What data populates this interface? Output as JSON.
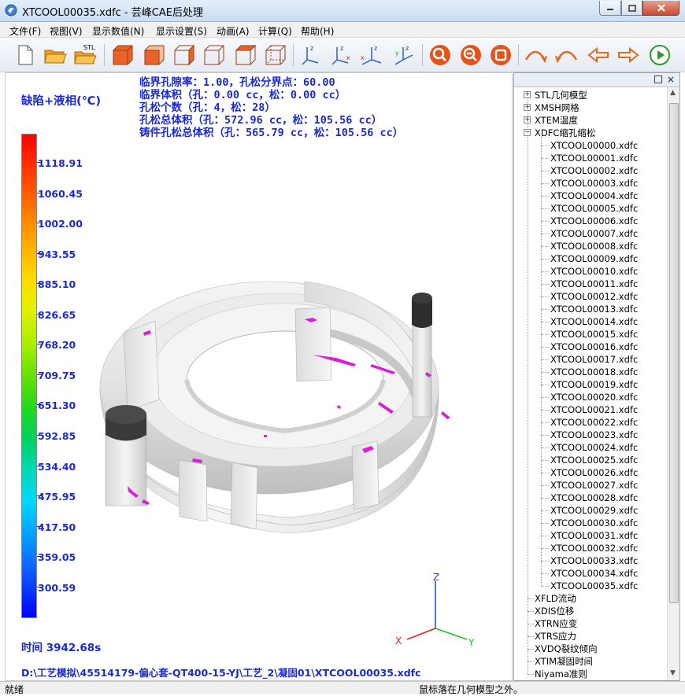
{
  "window": {
    "title": "XTCOOL00035.xdfc - 芸峰CAE后处理"
  },
  "menu": [
    "文件(F)",
    "视图(V)",
    "显示数值(N)",
    "显示设置(S)",
    "动画(A)",
    "计算(Q)",
    "帮助(H)"
  ],
  "toolbar": {
    "stl_label": "STL",
    "buttons": [
      "new-file-icon",
      "open-folder-icon",
      "open-stl-icon",
      "solid-cube-icon",
      "cube-front-icon",
      "cube-side-icon",
      "cube-wire-icon",
      "cube-top-icon",
      "cube-iso-icon",
      "view-axis-z-icon",
      "view-axis-x-icon",
      "view-axis-xz-icon",
      "view-axis-y-icon",
      "zoom-in-icon",
      "zoom-out-icon",
      "fit-view-icon",
      "rotate-cw-icon",
      "rotate-ccw-icon",
      "undo-arrow-icon",
      "redo-arrow-icon",
      "play-icon"
    ]
  },
  "info_lines": [
    "临界孔隙率：1.00，孔松分界点：60.00",
    "临界体积（孔：0.00 cc，松：0.00 cc）",
    "孔松个数（孔：4，松：28）",
    "孔松总体积（孔：572.96 cc，松：105.56 cc）",
    "铸件孔松总体积（孔：565.79 cc，松：105.56 cc）"
  ],
  "legend": {
    "title": "缺陷+液相(℃)",
    "ticks": [
      "1118.91",
      "1060.45",
      "1002.00",
      "943.55",
      "885.10",
      "826.65",
      "768.20",
      "709.75",
      "651.30",
      "592.85",
      "534.40",
      "475.95",
      "417.50",
      "359.05",
      "300.59"
    ]
  },
  "time_label": "时间 3942.68s",
  "file_path": "D:\\工艺模拟\\45514179-偏心套-QT400-15-YJ\\工艺_2\\凝固01\\XTCOOL00035.xdfc",
  "axes": {
    "z": "Z",
    "x": "X",
    "y": "Y"
  },
  "tree": {
    "top_groups": [
      "STL几何模型",
      "XMSH网格",
      "XTEM温度",
      "XDFC缩孔缩松"
    ],
    "files": [
      "XTCOOL00000.xdfc",
      "XTCOOL00001.xdfc",
      "XTCOOL00002.xdfc",
      "XTCOOL00003.xdfc",
      "XTCOOL00004.xdfc",
      "XTCOOL00005.xdfc",
      "XTCOOL00006.xdfc",
      "XTCOOL00007.xdfc",
      "XTCOOL00008.xdfc",
      "XTCOOL00009.xdfc",
      "XTCOOL00010.xdfc",
      "XTCOOL00011.xdfc",
      "XTCOOL00012.xdfc",
      "XTCOOL00013.xdfc",
      "XTCOOL00014.xdfc",
      "XTCOOL00015.xdfc",
      "XTCOOL00016.xdfc",
      "XTCOOL00017.xdfc",
      "XTCOOL00018.xdfc",
      "XTCOOL00019.xdfc",
      "XTCOOL00020.xdfc",
      "XTCOOL00021.xdfc",
      "XTCOOL00022.xdfc",
      "XTCOOL00023.xdfc",
      "XTCOOL00024.xdfc",
      "XTCOOL00025.xdfc",
      "XTCOOL00026.xdfc",
      "XTCOOL00027.xdfc",
      "XTCOOL00028.xdfc",
      "XTCOOL00029.xdfc",
      "XTCOOL00030.xdfc",
      "XTCOOL00031.xdfc",
      "XTCOOL00032.xdfc",
      "XTCOOL00033.xdfc",
      "XTCOOL00034.xdfc",
      "XTCOOL00035.xdfc"
    ],
    "bottom_items": [
      "XFLD流动",
      "XDIS位移",
      "XTRN应变",
      "XTRS应力",
      "XVDQ裂纹倾向",
      "XTIM凝固时间",
      "Niyama准则"
    ]
  },
  "status": {
    "left": "就绪",
    "right": "鼠标落在几何模型之外。"
  }
}
